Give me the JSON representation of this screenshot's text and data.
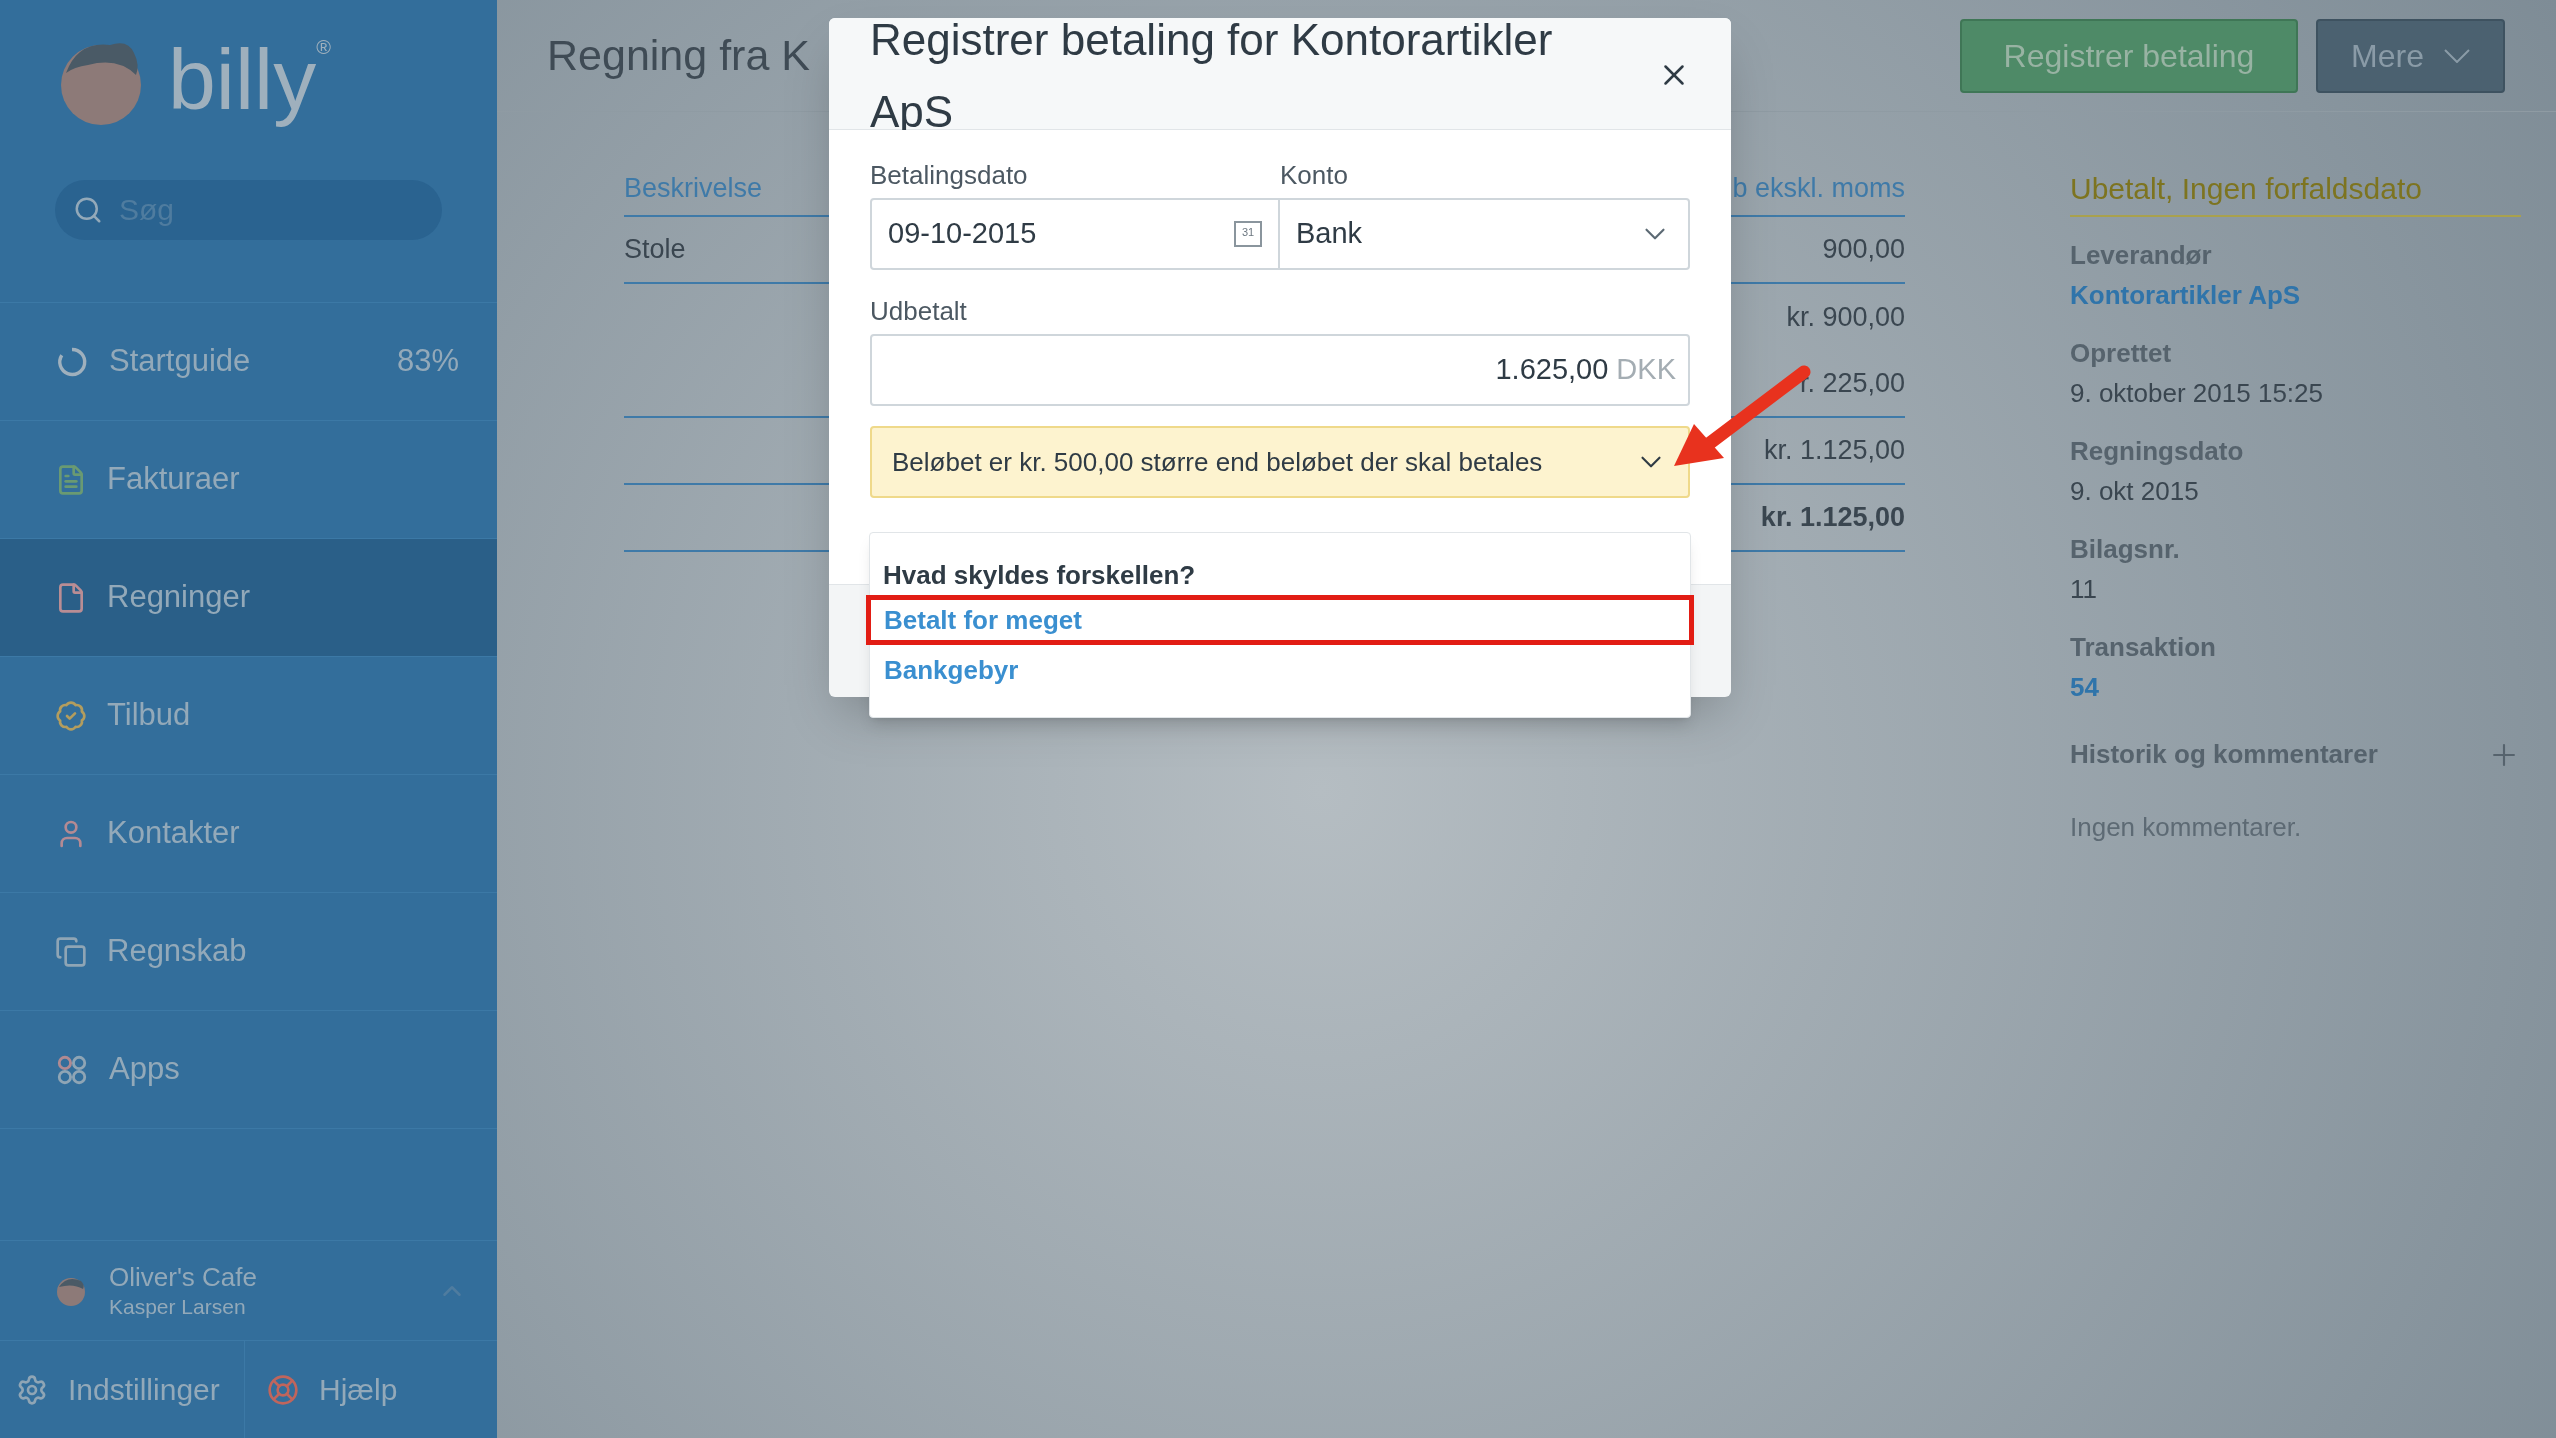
{
  "sidebar": {
    "logo": {
      "name": "billy",
      "mark": "®"
    },
    "search": {
      "placeholder": "Søg"
    },
    "items": [
      {
        "label": "Startguide",
        "value": "83%",
        "selected": false
      },
      {
        "label": "Fakturaer",
        "selected": false
      },
      {
        "label": "Regninger",
        "selected": true
      },
      {
        "label": "Tilbud",
        "selected": false
      },
      {
        "label": "Kontakter",
        "selected": false
      },
      {
        "label": "Regnskab",
        "selected": false
      },
      {
        "label": "Apps",
        "selected": false
      }
    ],
    "account": {
      "company": "Oliver's Cafe",
      "user": "Kasper Larsen"
    },
    "footer": [
      "Indstillinger",
      "Hjælp"
    ]
  },
  "page": {
    "title": "Regning fra K",
    "buttons": [
      {
        "label": "Registrer betaling",
        "kind": "primary"
      },
      {
        "label": "Mere",
        "kind": "menu"
      }
    ],
    "table": {
      "columns": [
        "Beskrivelse",
        "b ekskl. moms"
      ],
      "rows": [
        [
          "Stole",
          "900,00"
        ]
      ],
      "totals": [
        {
          "value": "kr. 900,00",
          "kind": "line"
        },
        {
          "value": "r. 225,00",
          "kind": "line"
        },
        {
          "value": "kr. 1.125,00",
          "kind": "line"
        },
        {
          "value": "kr. 1.125,00",
          "kind": "grand"
        }
      ]
    },
    "details": {
      "status": "Ubetalt, Ingen forfaldsdato",
      "fields": [
        {
          "label": "Leverandør",
          "value": "Kontorartikler ApS",
          "link": true
        },
        {
          "label": "Oprettet",
          "value": "9. oktober 2015 15:25",
          "link": false
        },
        {
          "label": "Regningsdato",
          "value": "9. okt 2015",
          "link": false
        },
        {
          "label": "Bilagsnr.",
          "value": "11",
          "link": false
        },
        {
          "label": "Transaktion",
          "value": "54",
          "link": true
        }
      ],
      "history": {
        "title": "Historik og kommentarer",
        "empty": "Ingen kommentarer."
      }
    }
  },
  "modal": {
    "title": "Registrer betaling for Kontorartikler ApS",
    "date": {
      "label": "Betalingsdato",
      "value": "09-10-2015",
      "icon_text": "31"
    },
    "account": {
      "label": "Konto",
      "value": "Bank"
    },
    "amount": {
      "label": "Udbetalt",
      "value": "1.625,00",
      "currency": "DKK"
    },
    "warning": "Beløbet er kr. 500,00 større end beløbet der skal betales",
    "popover": {
      "heading": "Hvad skyldes forskellen?",
      "options": [
        {
          "label": "Betalt for meget",
          "highlighted": true
        },
        {
          "label": "Bankgebyr",
          "highlighted": false
        }
      ]
    }
  }
}
